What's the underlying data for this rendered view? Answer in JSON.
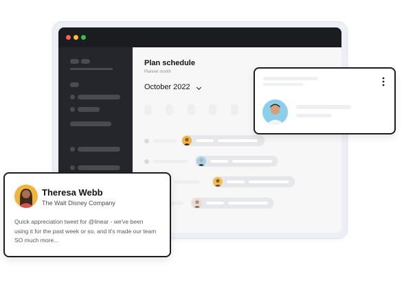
{
  "window": {
    "controls": [
      {
        "name": "close",
        "color": "#ff5f57"
      },
      {
        "name": "minimize",
        "color": "#febc2e"
      },
      {
        "name": "maximize",
        "color": "#28c840"
      }
    ]
  },
  "main": {
    "title": "Plan schedule",
    "subtitle": "Planner month",
    "month_label": "October 2022",
    "month_icon": "chevron-down-icon"
  },
  "testimonial": {
    "name": "Theresa Webb",
    "company": "The Walt Disney Company",
    "quote": "Quick appreciation tweet for @linear - we've been using it for the past week or so, and it's made our team SO much more..."
  },
  "side_card": {
    "menu_icon": "more-vertical-icon"
  },
  "colors": {
    "titlebar": "#1b1c1f",
    "sidebar": "#25262b",
    "main_bg": "#f7f7f8",
    "card_border": "#1b1c1f"
  }
}
